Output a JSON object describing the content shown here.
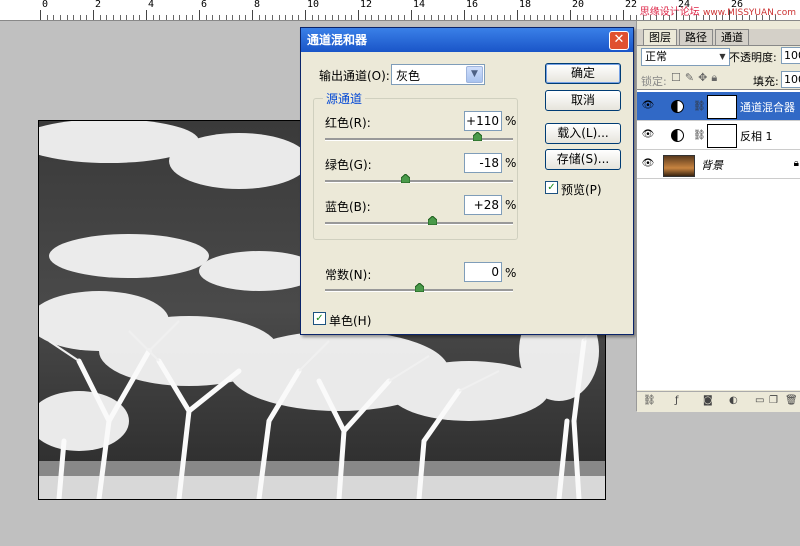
{
  "ruler": {
    "numbers": [
      "0",
      "2",
      "4",
      "6",
      "8",
      "10",
      "12",
      "14",
      "16",
      "18",
      "20",
      "22",
      "24",
      "26"
    ]
  },
  "watermark": {
    "text": "思缘设计论坛",
    "url": "www.MISSYUAN.com"
  },
  "dialog": {
    "title": "通道混和器",
    "output_channel_label": "输出通道(O):",
    "output_channel_value": "灰色",
    "source_group_label": "源通道",
    "channels": [
      {
        "label": "红色(R):",
        "value": "+110",
        "fraction": 0.81
      },
      {
        "label": "绿色(G):",
        "value": "-18",
        "fraction": 0.43
      },
      {
        "label": "蓝色(B):",
        "value": "+28",
        "fraction": 0.57
      }
    ],
    "constant": {
      "label": "常数(N):",
      "value": "0",
      "fraction": 0.5
    },
    "percent": "%",
    "monochrome_label": "单色(H)",
    "monochrome_checked": true,
    "buttons": {
      "ok": "确定",
      "cancel": "取消",
      "load": "载入(L)...",
      "save": "存储(S)..."
    },
    "preview_label": "预览(P)",
    "preview_checked": true
  },
  "layers_panel": {
    "tabs": [
      "图层",
      "路径",
      "通道"
    ],
    "blend_mode": "正常",
    "opacity_label": "不透明度:",
    "opacity_value": "100",
    "lock_label": "锁定:",
    "fill_label": "填充:",
    "fill_value": "100",
    "layers": [
      {
        "name": "通道混合器",
        "selected": true
      },
      {
        "name": "反相 1",
        "selected": false
      },
      {
        "name": "背景",
        "selected": false
      }
    ]
  }
}
